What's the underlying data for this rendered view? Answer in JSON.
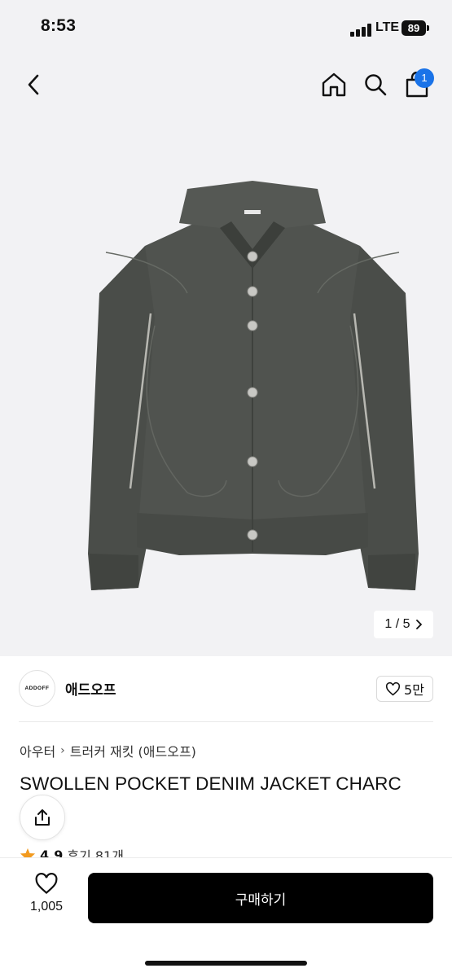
{
  "status_bar": {
    "time": "8:53",
    "network": "LTE",
    "battery": "89"
  },
  "header": {
    "cart_badge": "1"
  },
  "gallery": {
    "current": "1 / 5"
  },
  "brand": {
    "logo_text": "ADDOFF",
    "name": "애드오프",
    "likes": "5만"
  },
  "breadcrumb": {
    "category": "아우터",
    "subcategory": "트러커 재킷 (애드오프)"
  },
  "product": {
    "title": "SWOLLEN POCKET DENIM JACKET CHARC"
  },
  "rating": {
    "score": "4.9",
    "reviews": "후기 81개"
  },
  "bottom": {
    "wish_count": "1,005",
    "buy_label": "구매하기"
  },
  "colors": {
    "accent": "#1a73e8",
    "star": "#f29a1f",
    "jacket": "#4c4f4b"
  },
  "icons": [
    "back-icon",
    "home-icon",
    "search-icon",
    "cart-icon",
    "chevron-right-icon",
    "heart-icon",
    "share-icon",
    "star-icon"
  ]
}
